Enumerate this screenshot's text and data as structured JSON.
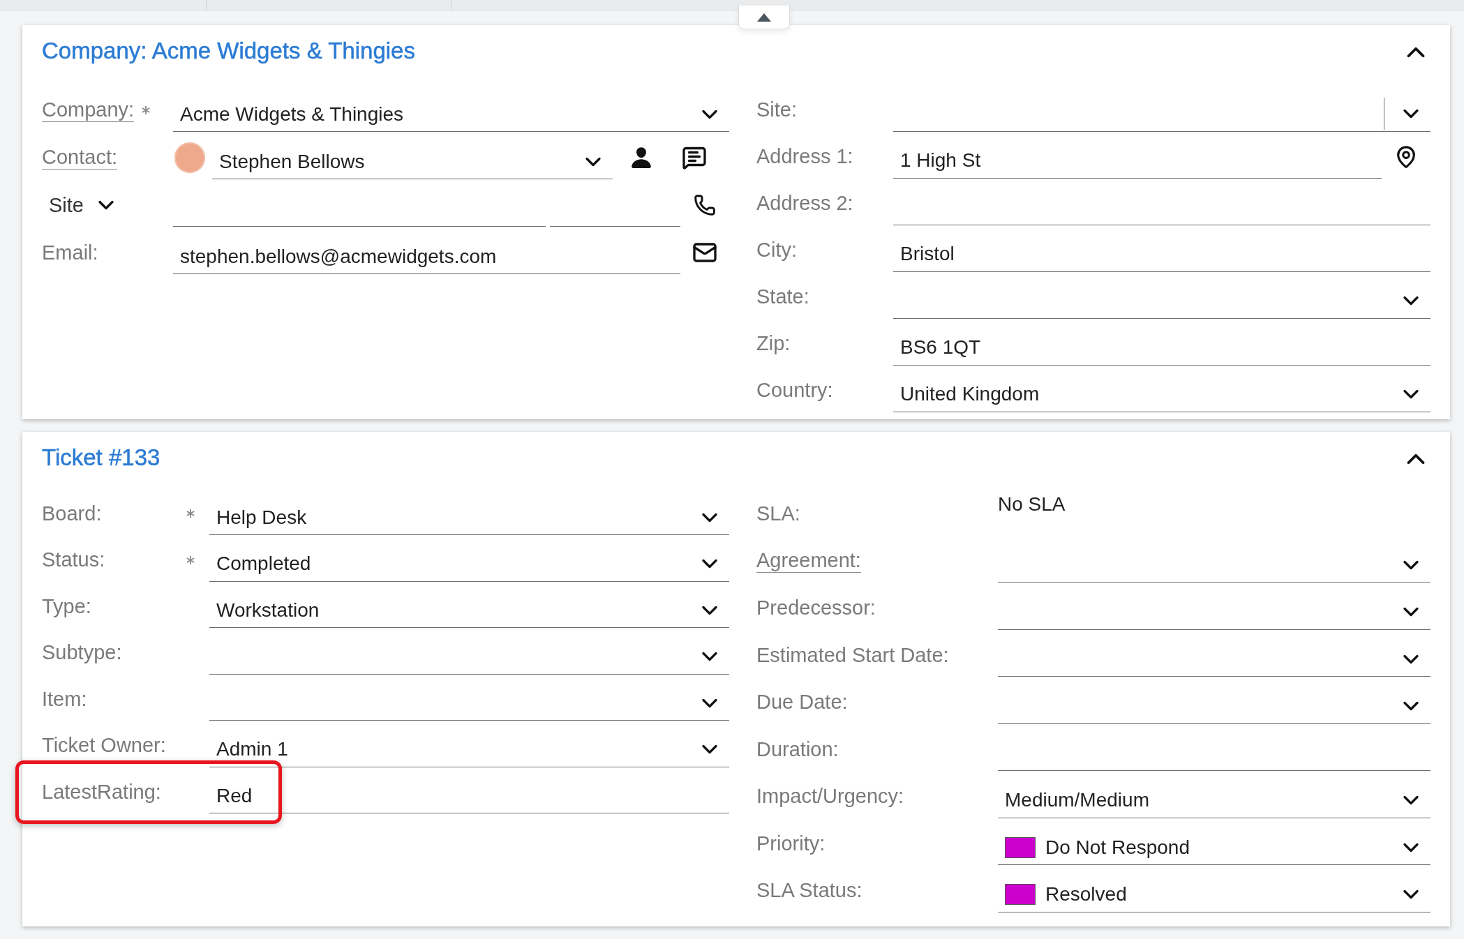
{
  "company_section": {
    "title": "Company: Acme Widgets & Thingies",
    "expanded": true,
    "left_fields": [
      {
        "kind": "dropdown",
        "label": "Company:",
        "link": true,
        "required": true,
        "highlighted": false,
        "value": "Acme Widgets & Thingies"
      },
      {
        "kind": "contact",
        "label": "Contact:",
        "link": true,
        "required": false,
        "highlighted": false,
        "value": "Stephen Bellows"
      },
      {
        "kind": "site_phone",
        "label": "Site",
        "link": false,
        "required": false,
        "highlighted": false
      },
      {
        "kind": "email",
        "label": "Email:",
        "link": false,
        "required": false,
        "highlighted": false,
        "value": "stephen.bellows@acmewidgets.com"
      }
    ],
    "right_fields": [
      {
        "kind": "combo",
        "label": "Site:",
        "link": false,
        "required": false,
        "highlighted": false
      },
      {
        "kind": "location",
        "label": "Address 1:",
        "link": false,
        "required": false,
        "highlighted": false,
        "value": "1 High St"
      },
      {
        "kind": "text",
        "label": "Address 2:",
        "link": false,
        "required": false,
        "highlighted": false
      },
      {
        "kind": "text",
        "label": "City:",
        "link": false,
        "required": false,
        "highlighted": false,
        "value": "Bristol"
      },
      {
        "kind": "dropdown",
        "label": "State:",
        "link": false,
        "required": false,
        "highlighted": false
      },
      {
        "kind": "text",
        "label": "Zip:",
        "link": false,
        "required": false,
        "highlighted": false,
        "value": "BS6 1QT"
      },
      {
        "kind": "dropdown",
        "label": "Country:",
        "link": false,
        "required": false,
        "highlighted": false,
        "value": "United Kingdom"
      }
    ]
  },
  "ticket_section": {
    "title": "Ticket #133",
    "expanded": true,
    "left_fields": [
      {
        "kind": "dropdown",
        "label": "Board:",
        "link": false,
        "required": true,
        "highlighted": false,
        "value": "Help Desk"
      },
      {
        "kind": "dropdown",
        "label": "Status:",
        "link": false,
        "required": true,
        "highlighted": false,
        "value": "Completed"
      },
      {
        "kind": "dropdown",
        "label": "Type:",
        "link": false,
        "required": false,
        "highlighted": false,
        "value": "Workstation"
      },
      {
        "kind": "dropdown",
        "label": "Subtype:",
        "link": false,
        "required": false,
        "highlighted": false
      },
      {
        "kind": "dropdown",
        "label": "Item:",
        "link": false,
        "required": false,
        "highlighted": false
      },
      {
        "kind": "dropdown",
        "label": "Ticket Owner:",
        "link": false,
        "required": false,
        "highlighted": false,
        "value": "Admin 1"
      },
      {
        "kind": "text",
        "label": "LatestRating:",
        "link": false,
        "required": false,
        "highlighted": true,
        "value": "Red"
      }
    ],
    "right_fields": [
      {
        "kind": "static",
        "label": "SLA:",
        "link": false,
        "required": false,
        "highlighted": false,
        "value": "No SLA"
      },
      {
        "kind": "dropdown",
        "label": "Agreement:",
        "link": true,
        "required": false,
        "highlighted": false
      },
      {
        "kind": "dropdown",
        "label": "Predecessor:",
        "link": false,
        "required": false,
        "highlighted": false
      },
      {
        "kind": "dropdown",
        "label": "Estimated Start Date:",
        "link": false,
        "required": false,
        "highlighted": false
      },
      {
        "kind": "dropdown",
        "label": "Due Date:",
        "link": false,
        "required": false,
        "highlighted": false
      },
      {
        "kind": "text",
        "label": "Duration:",
        "link": false,
        "required": false,
        "highlighted": false
      },
      {
        "kind": "dropdown",
        "label": "Impact/Urgency:",
        "link": false,
        "required": false,
        "highlighted": false,
        "value": "Medium/Medium"
      },
      {
        "kind": "swatch",
        "label": "Priority:",
        "link": false,
        "required": false,
        "highlighted": false,
        "value": "Do Not Respond",
        "color": "#cc00cc"
      },
      {
        "kind": "swatch",
        "label": "SLA Status:",
        "link": false,
        "required": false,
        "highlighted": false,
        "value": "Resolved",
        "color": "#cc00cc"
      }
    ]
  }
}
